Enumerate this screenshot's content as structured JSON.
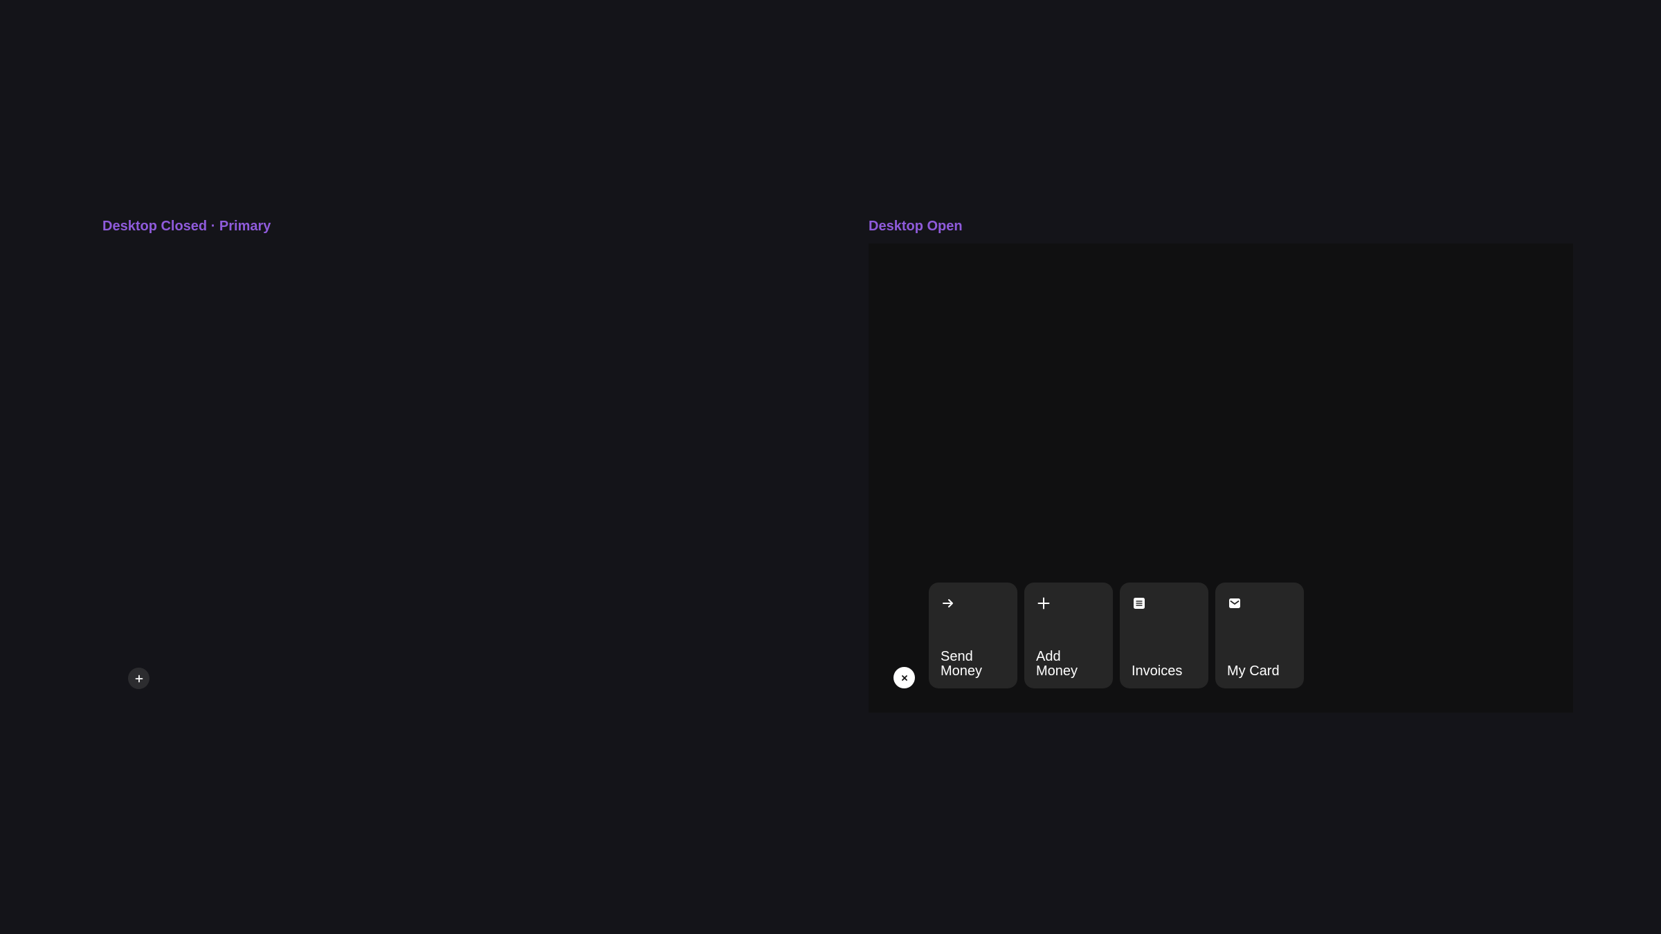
{
  "labels": {
    "closed": "Desktop Closed · Primary",
    "open": "Desktop Open"
  },
  "colors": {
    "background": "#141419",
    "accent_label": "#8f5bdb",
    "panel": "#101011",
    "card": "#262626",
    "fab_closed": "#2c2c2f",
    "fab_open": "#ffffff"
  },
  "closed_state": {
    "fab_icon": "plus-icon"
  },
  "open_state": {
    "fab_icon": "close-icon",
    "actions": [
      {
        "label": "Send Money",
        "icon": "arrow-right-icon"
      },
      {
        "label": "Add Money",
        "icon": "plus-icon"
      },
      {
        "label": "Invoices",
        "icon": "invoice-icon"
      },
      {
        "label": "My Card",
        "icon": "card-icon"
      }
    ]
  }
}
